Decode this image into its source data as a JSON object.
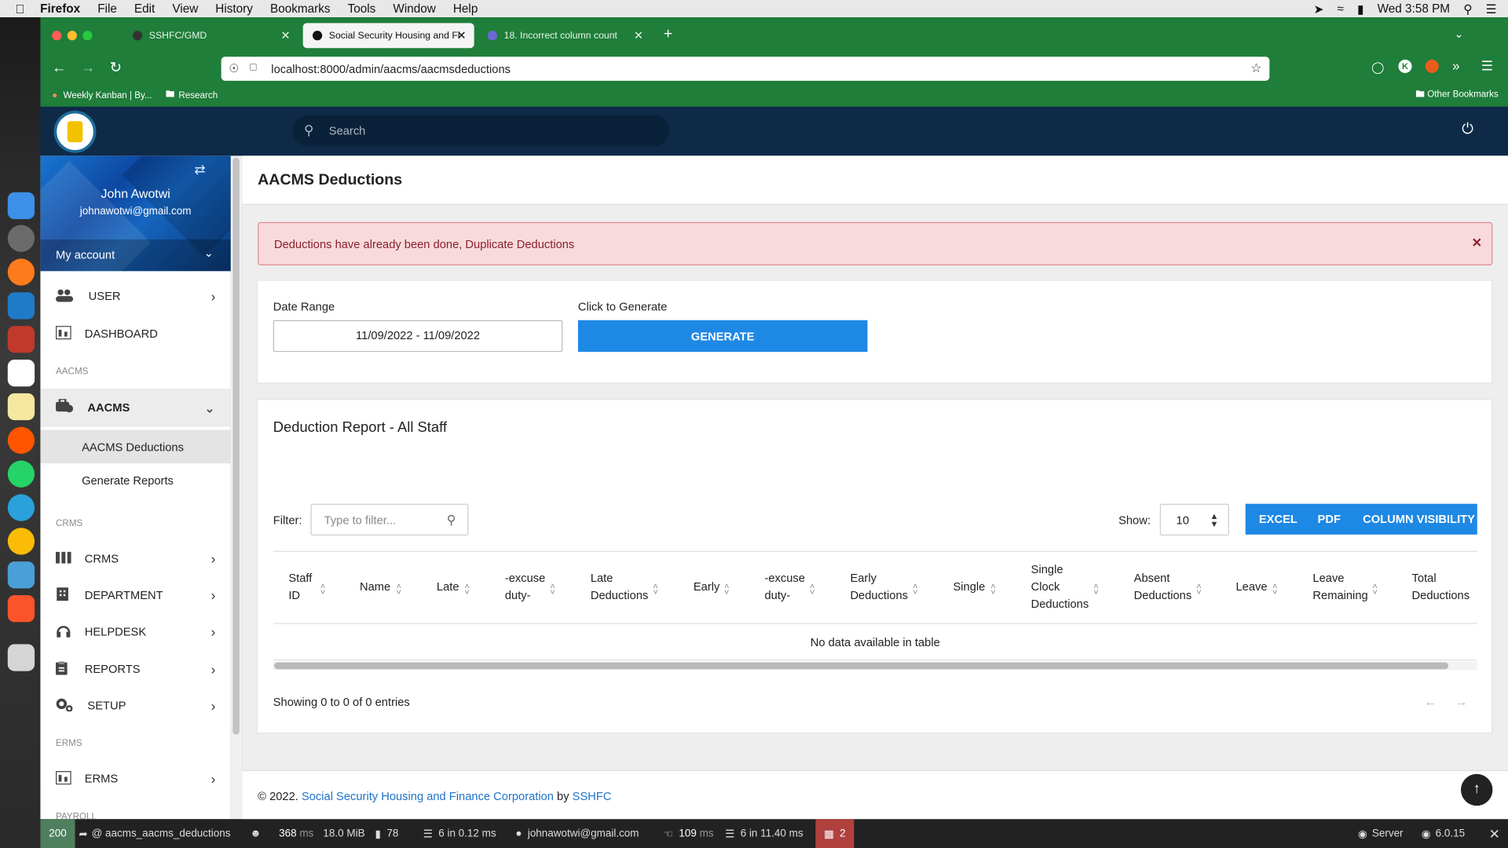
{
  "macos": {
    "app": "Firefox",
    "menus": [
      "File",
      "Edit",
      "View",
      "History",
      "Bookmarks",
      "Tools",
      "Window",
      "Help"
    ],
    "clock": "Wed 3:58 PM"
  },
  "browser": {
    "tabs": [
      {
        "title": "SSHFC/GMD",
        "active": false
      },
      {
        "title": "Social Security Housing and Fina",
        "active": true
      },
      {
        "title": "18. Incorrect column count",
        "active": false
      }
    ],
    "url": "localhost:8000/admin/aacms/aacmsdeductions",
    "bookmarks": [
      "Weekly Kanban | By...",
      "Research"
    ],
    "other_bookmarks": "Other Bookmarks"
  },
  "header": {
    "search_placeholder": "Search"
  },
  "profile": {
    "name": "John Awotwi",
    "email": "johnawotwi@gmail.com",
    "my_account": "My account"
  },
  "sidebar": {
    "user": "USER",
    "dashboard": "DASHBOARD",
    "sec_aacms": "AACMS",
    "aacms": "AACMS",
    "aacms_deductions": "AACMS Deductions",
    "generate_reports": "Generate Reports",
    "sec_crms": "CRMS",
    "crms": "CRMS",
    "department": "DEPARTMENT",
    "helpdesk": "HELPDESK",
    "reports": "REPORTS",
    "setup": "SETUP",
    "sec_erms": "ERMS",
    "erms": "ERMS",
    "sec_payroll": "PAYROLL"
  },
  "page": {
    "title": "AACMS Deductions",
    "alert": "Deductions have already been done, Duplicate Deductions",
    "date_range_label": "Date Range",
    "date_range_value": "11/09/2022 - 11/09/2022",
    "click_to_generate": "Click to Generate",
    "generate": "GENERATE",
    "report_title": "Deduction Report - All Staff",
    "filter_label": "Filter:",
    "filter_placeholder": "Type to filter...",
    "show_label": "Show:",
    "show_value": "10",
    "excel": "EXCEL",
    "pdf": "PDF",
    "column_visibility": "COLUMN VISIBILITY",
    "columns": [
      [
        "Staff",
        "ID"
      ],
      [
        "Name"
      ],
      [
        "Late"
      ],
      [
        "-excuse",
        "duty-"
      ],
      [
        "Late",
        "Deductions"
      ],
      [
        "Early"
      ],
      [
        "-excuse",
        "duty-"
      ],
      [
        "Early",
        "Deductions"
      ],
      [
        "Single"
      ],
      [
        "Single",
        "Clock",
        "Deductions"
      ],
      [
        "Absent",
        "Deductions"
      ],
      [
        "Leave"
      ],
      [
        "Leave",
        "Remaining"
      ],
      [
        "Total",
        "Deductions"
      ]
    ],
    "empty": "No data available in table",
    "showing": "Showing 0 to 0 of 0 entries"
  },
  "footer": {
    "copy": "© 2022.",
    "org": "Social Security Housing and Finance Corporation",
    "by": "by",
    "link": "SSHFC"
  },
  "debugbar": {
    "status": "200",
    "route": "@ aacms_aacms_deductions",
    "time": "368",
    "time_unit": "ms",
    "memory": "18.0 MiB",
    "count": "78",
    "db": "6 in 0.12 ms",
    "user": "johnawotwi@gmail.com",
    "render": "109",
    "render_unit": "ms",
    "cache": "6 in 11.40 ms",
    "errors": "2",
    "server": "Server",
    "version": "6.0.15"
  },
  "colors": {
    "firefox_green": "#1e7e3a",
    "header_navy": "#0e2a47",
    "primary": "#1e88e5",
    "alert_bg": "#f8dadc"
  }
}
